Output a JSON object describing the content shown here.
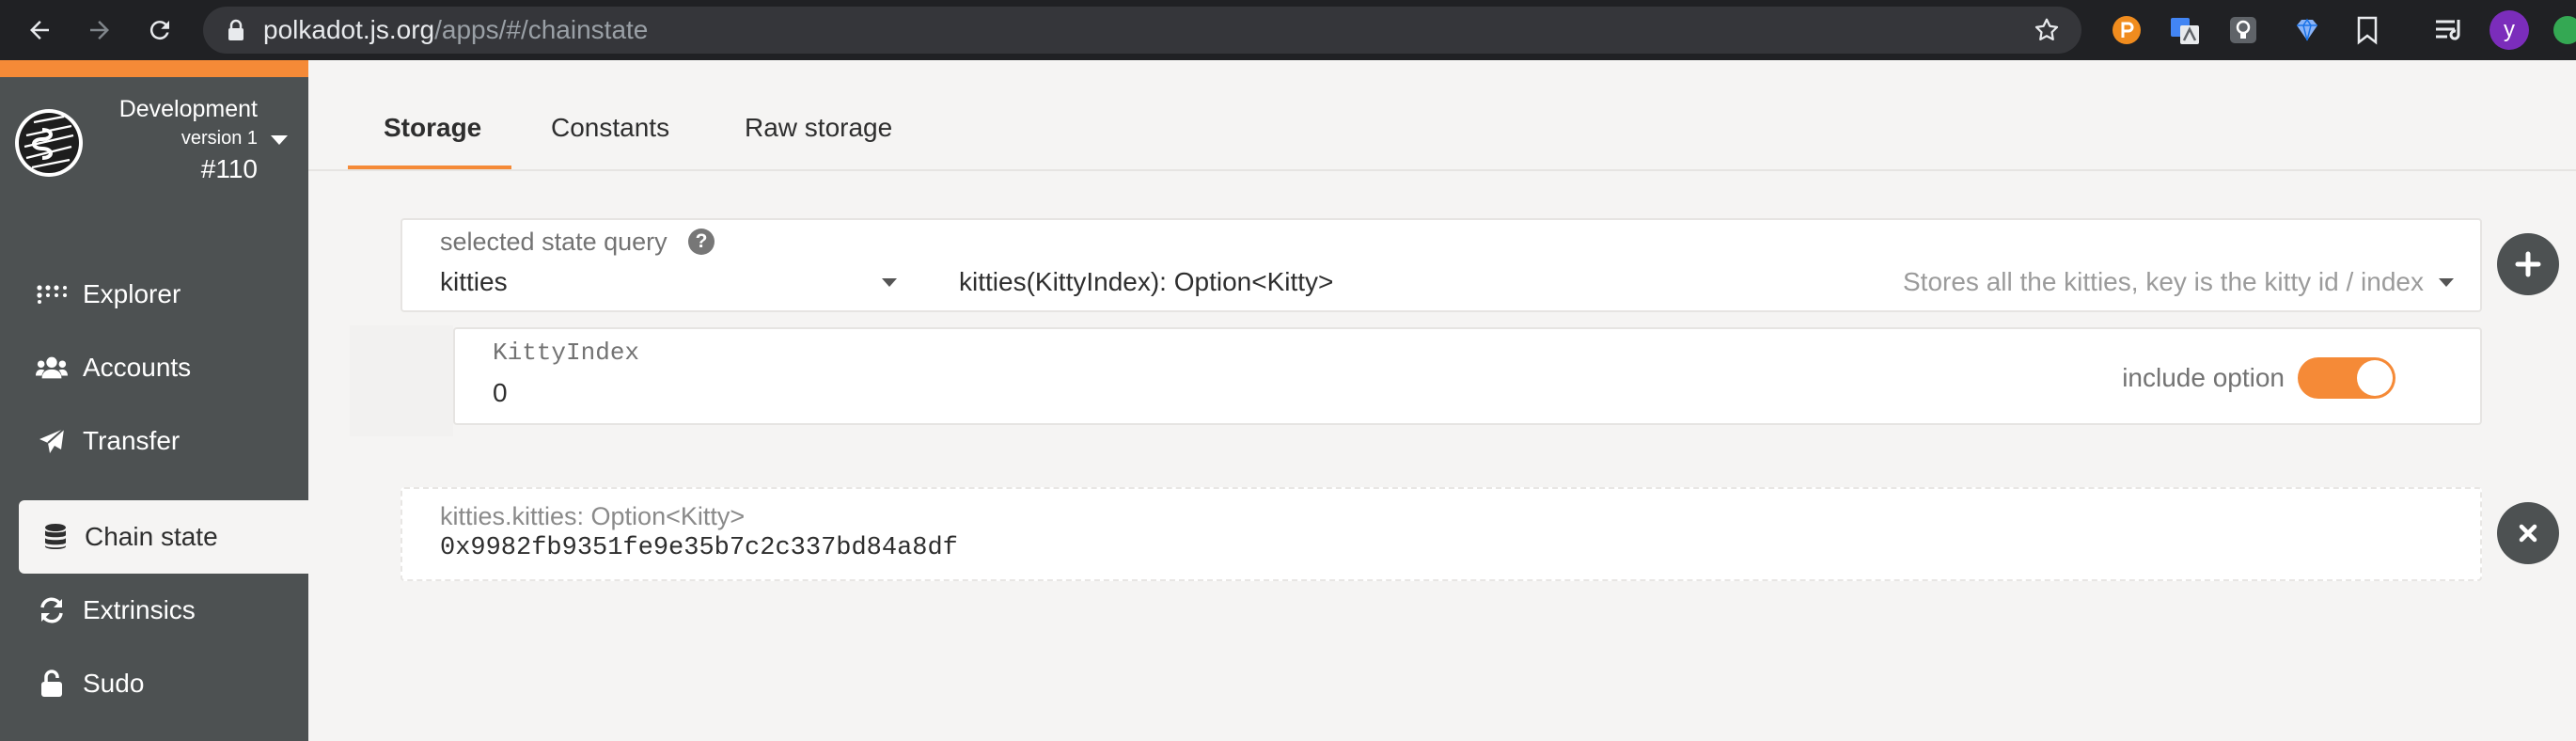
{
  "browser": {
    "url_domain": "polkadot.js.org",
    "url_path": "/apps/#/chainstate",
    "profile_initial": "y"
  },
  "sidebar": {
    "chain_name": "Development",
    "chain_version": "version 1",
    "block_number": "#110",
    "items": [
      {
        "label": "Explorer",
        "icon": "grid-dots-icon"
      },
      {
        "label": "Accounts",
        "icon": "users-icon"
      },
      {
        "label": "Transfer",
        "icon": "paper-plane-icon"
      },
      {
        "label": "Chain state",
        "icon": "database-icon",
        "active": true
      },
      {
        "label": "Extrinsics",
        "icon": "sync-icon"
      },
      {
        "label": "Sudo",
        "icon": "unlock-icon"
      }
    ],
    "accent_color": "#f58a37",
    "background_color": "#4d5152"
  },
  "tabs": {
    "items": [
      {
        "label": "Storage",
        "active": true
      },
      {
        "label": "Constants"
      },
      {
        "label": "Raw storage"
      }
    ]
  },
  "query": {
    "label": "selected state query",
    "help_glyph": "?",
    "section": "kitties",
    "method": "kitties(KittyIndex): Option<Kitty>",
    "description": "Stores all the kitties, key is the kitty id / index"
  },
  "param": {
    "label": "KittyIndex",
    "value": "0",
    "option_label": "include option",
    "option_enabled": true
  },
  "result": {
    "label": "kitties.kitties: Option<Kitty>",
    "value": "0x9982fb9351fe9e35b7c2c337bd84a8df"
  }
}
